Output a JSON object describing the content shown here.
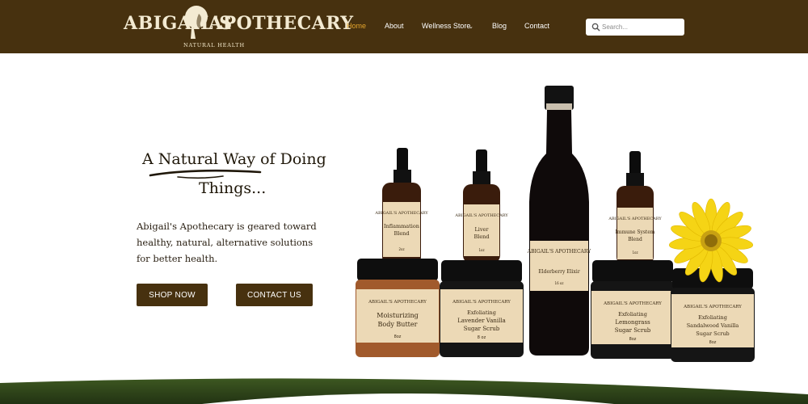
{
  "header": {
    "logo_left": "ABIGAIL'S",
    "logo_right": "APOTHECARY",
    "logo_sub": "NATURAL HEALTH",
    "nav": [
      {
        "label": "Home",
        "active": true
      },
      {
        "label": "About",
        "active": false
      },
      {
        "label": "Wellness Store",
        "active": false,
        "has_dropdown": true
      },
      {
        "label": "Blog",
        "active": false
      },
      {
        "label": "Contact",
        "active": false
      }
    ],
    "search": {
      "placeholder": "Search...",
      "value": ""
    }
  },
  "hero": {
    "heading_line1": "A Natural Way of Doing",
    "heading_line2": "Things...",
    "lead": "Abigail's Apothecary is geared toward healthy, natural, alternative solutions for better health.",
    "buttons": {
      "shop": "SHOP NOW",
      "contact": "CONTACT US"
    }
  },
  "products": {
    "dropper1": {
      "line1": "Inflammation",
      "line2": "Blend",
      "size": "2oz"
    },
    "dropper2": {
      "line1": "Liver",
      "line2": "Blend",
      "size": "1oz"
    },
    "bottle": {
      "line1": "Elderberry Elixir",
      "size": "16 oz"
    },
    "dropper3": {
      "line1": "Immune System",
      "line2": "Blend",
      "size": "1oz"
    },
    "jar1": {
      "brand": "ABIGAIL'S APOTHECARY",
      "line1": "Moisturizing",
      "line2": "Body Butter",
      "size": "8oz"
    },
    "jar2": {
      "brand": "ABIGAIL'S APOTHECARY",
      "line1": "Exfoliating",
      "line2": "Lavender Vanilla",
      "line3": "Sugar Scrub",
      "size": "8 oz"
    },
    "bottle_brand": "ABIGAIL'S APOTHECARY",
    "jar3": {
      "brand": "ABIGAIL'S APOTHECARY",
      "line1": "Exfoliating",
      "line2": "Lemongrass",
      "line3": "Sugar Scrub",
      "size": "8oz"
    },
    "jar4": {
      "brand": "ABIGAIL'S APOTHECARY",
      "line1": "Exfoliating",
      "line2": "Sandalwood Vanilla",
      "line3": "Sugar Scrub",
      "size": "8oz"
    }
  },
  "colors": {
    "brand_brown": "#47310f",
    "nav_active": "#e3a42c",
    "label_cream": "#ecd9b6"
  }
}
